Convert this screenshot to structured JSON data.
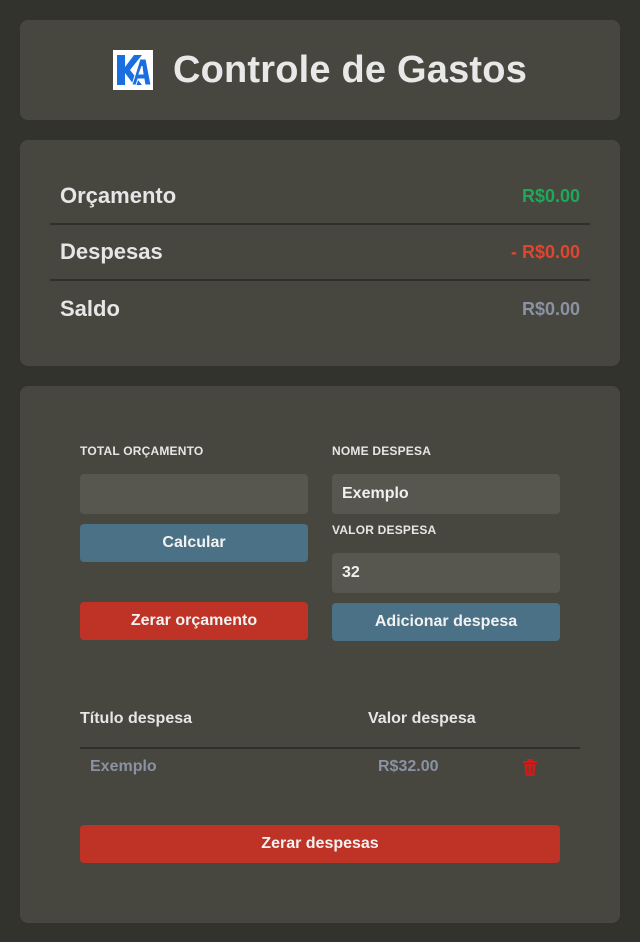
{
  "header": {
    "title": "Controle de Gastos",
    "logo_icon": "ka-logo-icon"
  },
  "summary": {
    "rows": [
      {
        "label": "Orçamento",
        "value": "R$0.00",
        "color": "#1fa85a"
      },
      {
        "label": "Despesas",
        "value": "- R$0.00",
        "color": "#e0462f"
      },
      {
        "label": "Saldo",
        "value": "R$0.00",
        "color": "#8a92a3"
      }
    ]
  },
  "budget": {
    "label": "TOTAL ORÇAMENTO",
    "input_value": "",
    "calculate_label": "Calcular",
    "reset_label": "Zerar orçamento"
  },
  "expense_form": {
    "name_label": "NOME DESPESA",
    "name_value": "Exemplo",
    "value_label": "VALOR DESPESA",
    "value_value": "32",
    "add_label": "Adicionar despesa"
  },
  "table": {
    "headers": [
      "Título despesa",
      "Valor despesa"
    ],
    "rows": [
      {
        "title": "Exemplo",
        "value": "R$32.00",
        "action_icon": "trash-icon"
      }
    ]
  },
  "reset_expenses_label": "Zerar despesas",
  "colors": {
    "accent_blue": "#4a7185",
    "danger_red": "#bf3326",
    "trash_red": "#d11a1a"
  }
}
